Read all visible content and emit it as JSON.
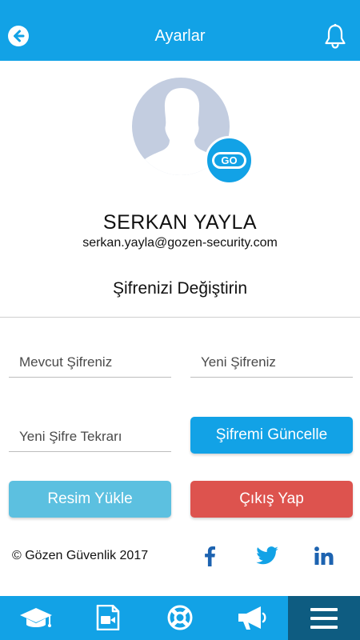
{
  "header": {
    "title": "Ayarlar",
    "back_icon": "arrow-left-circle-icon",
    "notification_icon": "bell-icon"
  },
  "profile": {
    "name": "SERKAN YAYLA",
    "email": "serkan.yayla@gozen-security.com",
    "badge_text": "GO"
  },
  "password_section": {
    "title": "Şifrenizi Değiştirin",
    "current_password_placeholder": "Mevcut Şifreniz",
    "new_password_placeholder": "Yeni Şifreniz",
    "repeat_password_placeholder": "Yeni Şifre Tekrarı",
    "update_button": "Şifremi Güncelle"
  },
  "actions": {
    "upload_photo": "Resim Yükle",
    "logout": "Çıkış Yap"
  },
  "footer": {
    "copyright": "© Gözen Güvenlik 2017",
    "social_icons": [
      "facebook-icon",
      "twitter-icon",
      "linkedin-icon"
    ]
  },
  "tabbar": {
    "items": [
      {
        "icon": "graduation-cap-icon",
        "active": false
      },
      {
        "icon": "video-file-icon",
        "active": false
      },
      {
        "icon": "lifebuoy-icon",
        "active": false
      },
      {
        "icon": "megaphone-icon",
        "active": false
      },
      {
        "icon": "menu-icon",
        "active": true
      }
    ]
  },
  "colors": {
    "primary": "#12a2e6",
    "active_tab": "#0e5c81",
    "upload_button": "#5cc0e0",
    "logout_button": "#dd534e",
    "social": "#1d63b0",
    "avatar_bg": "#c3cde0"
  }
}
